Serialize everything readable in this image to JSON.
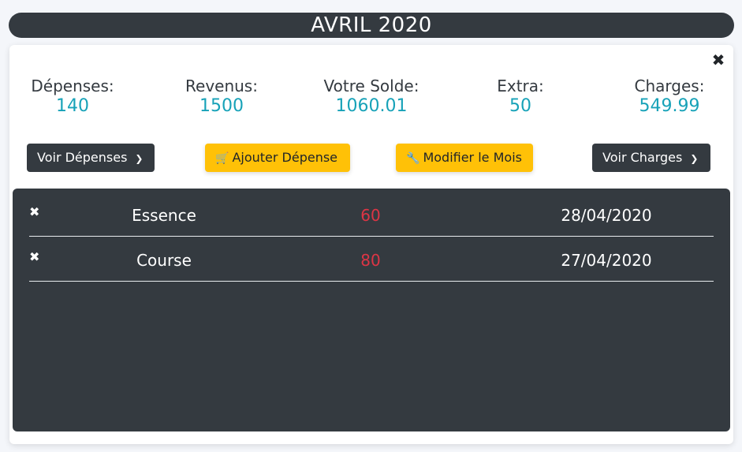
{
  "header": {
    "month_title": "AVRIL 2020"
  },
  "summary": {
    "depenses": {
      "label": "Dépenses:",
      "value": "140"
    },
    "revenus": {
      "label": "Revenus:",
      "value": "1500"
    },
    "solde": {
      "label": "Votre Solde:",
      "value": "1060.01"
    },
    "extra": {
      "label": "Extra:",
      "value": "50"
    },
    "charges": {
      "label": "Charges:",
      "value": "549.99"
    }
  },
  "actions": {
    "voir_depenses": "Voir Dépenses",
    "ajouter_depense": "Ajouter Dépense",
    "modifier_mois": "Modifier le Mois",
    "voir_charges": "Voir Charges"
  },
  "expenses": [
    {
      "name": "Essence",
      "amount": "60",
      "date": "28/04/2020"
    },
    {
      "name": "Course",
      "amount": "80",
      "date": "27/04/2020"
    }
  ],
  "icons": {
    "close": "close-icon",
    "cart": "cart-icon",
    "wrench": "wrench-icon",
    "chevron": "chevron-down-icon",
    "delete": "delete-icon"
  },
  "colors": {
    "dark": "#343a40",
    "warning": "#ffc107",
    "info": "#17a2b8",
    "danger": "#dc3545"
  }
}
